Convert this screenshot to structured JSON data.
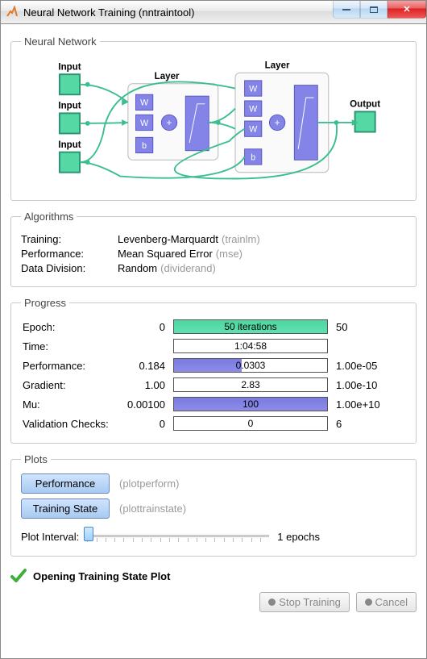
{
  "window": {
    "title": "Neural Network Training (nntraintool)"
  },
  "groups": {
    "network": "Neural Network",
    "algorithms": "Algorithms",
    "progress": "Progress",
    "plots": "Plots"
  },
  "diagram": {
    "input": "Input",
    "layer": "Layer",
    "output": "Output",
    "W": "W",
    "b": "b",
    "plus": "+"
  },
  "alg": {
    "training_label": "Training:",
    "training_value": "Levenberg-Marquardt",
    "training_func": "(trainlm)",
    "perf_label": "Performance:",
    "perf_value": "Mean Squared Error",
    "perf_func": "(mse)",
    "div_label": "Data Division:",
    "div_value": "Random",
    "div_func": "(dividerand)"
  },
  "progress": {
    "epoch": {
      "label": "Epoch:",
      "start": "0",
      "bar": "50 iterations",
      "end": "50",
      "fill_pct": 100,
      "style": "green"
    },
    "time": {
      "label": "Time:",
      "start": "",
      "bar": "1:04:58",
      "end": "",
      "fill_pct": 0,
      "style": "plain"
    },
    "perf": {
      "label": "Performance:",
      "start": "0.184",
      "bar": "0.0303",
      "end": "1.00e-05",
      "fill_pct": 44,
      "style": "purple"
    },
    "grad": {
      "label": "Gradient:",
      "start": "1.00",
      "bar": "2.83",
      "end": "1.00e-10",
      "fill_pct": 0,
      "style": "plain"
    },
    "mu": {
      "label": "Mu:",
      "start": "0.00100",
      "bar": "100",
      "end": "1.00e+10",
      "fill_pct": 100,
      "style": "full"
    },
    "val": {
      "label": "Validation Checks:",
      "start": "0",
      "bar": "0",
      "end": "6",
      "fill_pct": 0,
      "style": "plain"
    }
  },
  "plots": {
    "perf_btn": "Performance",
    "perf_func": "(plotperform)",
    "state_btn": "Training State",
    "state_func": "(plottrainstate)",
    "interval_label": "Plot Interval:",
    "interval_value": "1 epochs"
  },
  "status": "Opening Training State Plot",
  "footer": {
    "stop": "Stop Training",
    "cancel": "Cancel"
  },
  "colors": {
    "input_fill": "#56d8a5",
    "layer_fill": "#8484e8",
    "node_stroke": "#2a9470",
    "wire": "#3cbf90"
  }
}
